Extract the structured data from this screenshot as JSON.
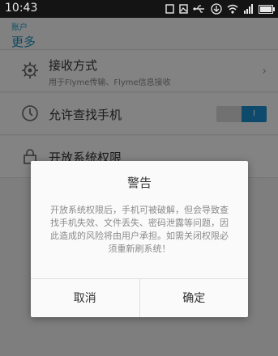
{
  "status_bar": {
    "time": "10:43",
    "icons": [
      "sim-icon",
      "photo-icon",
      "usb-icon",
      "download-icon",
      "wifi-icon",
      "signal-icon",
      "battery-icon"
    ]
  },
  "header": {
    "parent": "账户",
    "title": "更多"
  },
  "settings": {
    "receive": {
      "label": "接收方式",
      "sub": "用于Flyme传输、Flyme信息接收",
      "icon": "gear-icon"
    },
    "find_phone": {
      "label": "允许查找手机",
      "icon": "locate-icon",
      "toggle": "I",
      "enabled": true
    },
    "open_perms": {
      "label": "开放系统权限",
      "icon": "lock-icon"
    }
  },
  "dialog": {
    "title": "警告",
    "message": "开放系统权限后，手机可被破解，但会导致查找手机失效、文件丢失、密码泄露等问题，因此造成的风险将由用户承担。如需关闭权限必须重新刷系统！",
    "cancel": "取消",
    "confirm": "确定"
  },
  "colors": {
    "accent": "#1b8fce",
    "title": "#1a8fbf"
  }
}
